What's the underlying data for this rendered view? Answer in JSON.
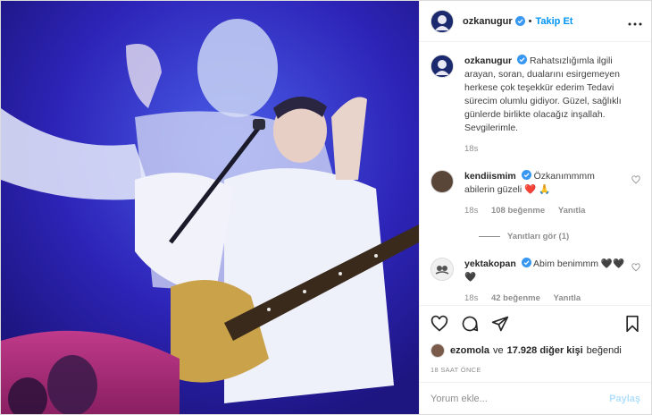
{
  "header": {
    "username": "ozkanugur",
    "dot": "•",
    "follow_label": "Takip Et",
    "more_icon": "more-horizontal-icon"
  },
  "caption": {
    "username": "ozkanugur",
    "text": "Rahatsızlığımla ilgili arayan, soran, dualarını esirgemeyen herkese çok teşekkür ederim Tedavi sürecim olumlu gidiyor. Güzel, sağlıklı günlerde birlikte olacağız inşallah. Sevgilerimle.",
    "time": "18s"
  },
  "comments": [
    {
      "username": "kendiismim",
      "text": "Özkanımmmm abilerin güzeli ❤️ 🙏",
      "time": "18s",
      "likes": "108 beğenme",
      "reply": "Yanıtla",
      "view_replies": "Yanıtları gör (1)"
    },
    {
      "username": "yektakopan",
      "text": "Abim benimmm 🖤🖤🖤",
      "time": "18s",
      "likes": "42 beğenme",
      "reply": "Yanıtla"
    }
  ],
  "likes": {
    "user": "ezomola",
    "connector": "ve",
    "others": "17.928 diğer kişi",
    "suffix": "beğendi"
  },
  "timestamp": "18 SAAT ÖNCE",
  "add_comment": {
    "placeholder": "Yorum ekle...",
    "post_label": "Paylaş"
  },
  "colors": {
    "accent": "#0095f6",
    "verified": "#3897f0",
    "photo_bg": "#2a1fa8"
  }
}
